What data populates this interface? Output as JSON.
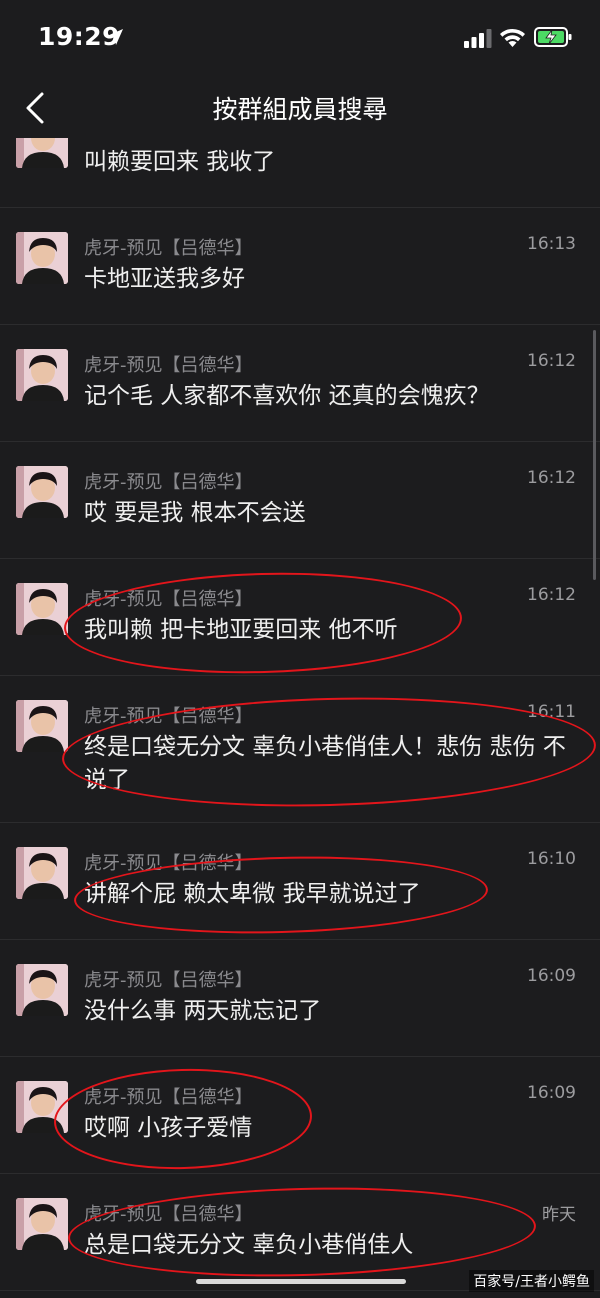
{
  "status_bar": {
    "time": "19:29"
  },
  "header": {
    "title": "按群組成員搜尋"
  },
  "top_partial": {
    "text": "叫赖要回来 我收了"
  },
  "results": [
    {
      "sender": "虎牙-预见【吕德华】",
      "time": "16:13",
      "text": "卡地亚送我多好"
    },
    {
      "sender": "虎牙-预见【吕德华】",
      "time": "16:12",
      "text": "记个毛 人家都不喜欢你 还真的会愧疚？"
    },
    {
      "sender": "虎牙-预见【吕德华】",
      "time": "16:12",
      "text": "哎 要是我 根本不会送"
    },
    {
      "sender": "虎牙-预见【吕德华】",
      "time": "16:12",
      "text": "我叫赖 把卡地亚要回来 他不听"
    },
    {
      "sender": "虎牙-预见【吕德华】",
      "time": "16:11",
      "text": "终是口袋无分文 辜负小巷俏佳人！悲伤 悲伤 不说了"
    },
    {
      "sender": "虎牙-预见【吕德华】",
      "time": "16:10",
      "text": "讲解个屁 赖太卑微 我早就说过了"
    },
    {
      "sender": "虎牙-预见【吕德华】",
      "time": "16:09",
      "text": "没什么事 两天就忘记了"
    },
    {
      "sender": "虎牙-预见【吕德华】",
      "time": "16:09",
      "text": "哎啊 小孩子爱情"
    },
    {
      "sender": "虎牙-预见【吕德华】",
      "time": "昨天",
      "text": "总是口袋无分文 辜负小巷俏佳人"
    }
  ],
  "watermark": "百家号/王者小鳄鱼",
  "colors": {
    "background": "#1c1c1e",
    "annotation": "#e3151b",
    "secondary_text": "#8a8a8e"
  },
  "icons": [
    "location-arrow-icon",
    "signal-icon",
    "wifi-icon",
    "battery-charging-icon",
    "back-chevron-icon"
  ]
}
